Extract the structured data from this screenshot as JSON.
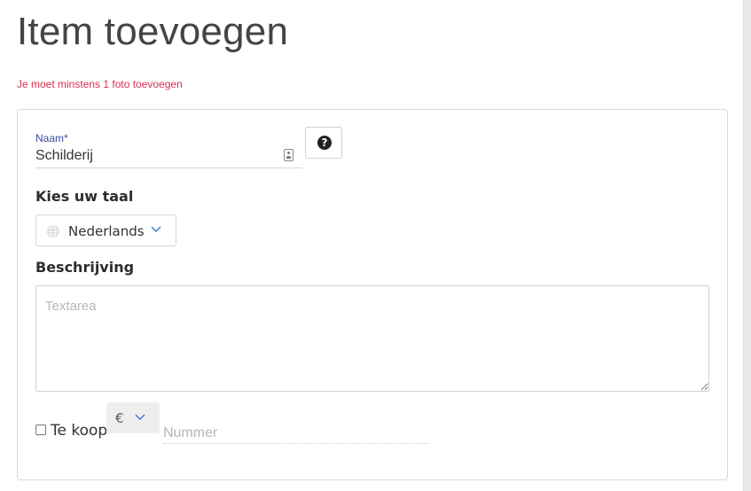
{
  "page": {
    "title": "Item toevoegen",
    "error": "Je moet minstens 1 foto toevoegen"
  },
  "form": {
    "name": {
      "label": "Naam*",
      "value": "Schilderij"
    },
    "language": {
      "heading": "Kies uw taal",
      "selected": "Nederlands"
    },
    "description": {
      "heading": "Beschrijving",
      "placeholder": "Textarea",
      "value": ""
    },
    "sale": {
      "label": "Te koop",
      "checked": false,
      "currency": "€",
      "price_placeholder": "Nummer",
      "price_value": ""
    }
  },
  "colors": {
    "error": "#d9304e",
    "float_label": "#3a4c9c",
    "chevron": "#3b7fd3"
  },
  "icons": {
    "help": "question-circle-icon",
    "language": "globe-icon",
    "dropdown": "chevron-down-icon",
    "autofill": "contact-card-icon"
  }
}
